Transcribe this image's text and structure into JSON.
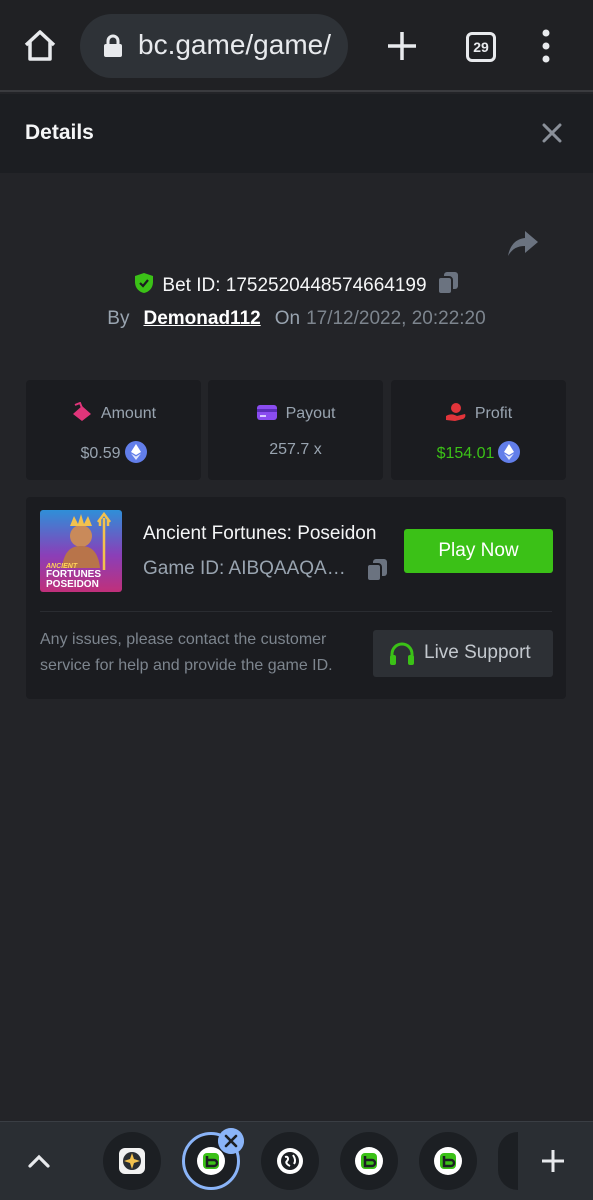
{
  "browser": {
    "url": "bc.game/game/",
    "tab_count": "29"
  },
  "details": {
    "title": "Details",
    "bet_id_label": "Bet ID:",
    "bet_id": "1752520448574664199",
    "by_label": "By",
    "username": "Demonad112",
    "on_label": "On",
    "datetime": "17/12/2022, 20:22:20"
  },
  "stats": {
    "amount_label": "Amount",
    "amount_value": "$0.59",
    "payout_label": "Payout",
    "payout_value": "257.7 x",
    "profit_label": "Profit",
    "profit_value": "$154.01"
  },
  "game": {
    "name": "Ancient Fortunes: Poseidon",
    "game_id": "Game ID: AIBQAAQAM...",
    "play_label": "Play Now",
    "thumb_line1": "ANCIENT",
    "thumb_line2": "FORTUNES",
    "thumb_line3": "POSEIDON",
    "support_note": "Any issues, please contact the customer service for help and provide the game ID.",
    "support_label": "Live Support"
  },
  "colors": {
    "accent_green": "#3bc117",
    "eth_blue": "#627eea",
    "background": "#232428",
    "card": "#1b1c20"
  },
  "icons": [
    "home-icon",
    "lock-icon",
    "plus-icon",
    "tabs-counter-icon",
    "kebab-menu-icon",
    "close-icon",
    "share-icon",
    "verified-shield-icon",
    "copy-icon",
    "amount-icon",
    "payout-card-icon",
    "profit-icon",
    "eth-coin-icon",
    "headset-icon",
    "chevron-up-icon"
  ]
}
